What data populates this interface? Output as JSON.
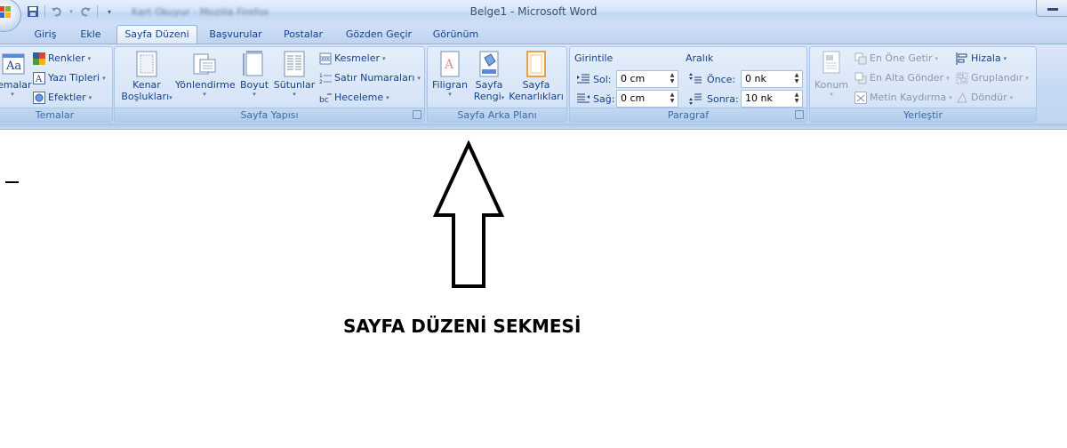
{
  "window": {
    "title": "Belge1 - Microsoft Word",
    "blurred_qat_text": "Kart Okuyur - Mozilla Firefox"
  },
  "qat": {
    "icons": [
      "save-icon",
      "undo-icon",
      "redo-icon",
      "customize-qat-icon"
    ]
  },
  "tabs": [
    {
      "label": "Giriş",
      "active": false
    },
    {
      "label": "Ekle",
      "active": false
    },
    {
      "label": "Sayfa Düzeni",
      "active": true
    },
    {
      "label": "Başvurular",
      "active": false
    },
    {
      "label": "Postalar",
      "active": false
    },
    {
      "label": "Gözden Geçir",
      "active": false
    },
    {
      "label": "Görünüm",
      "active": false
    }
  ],
  "groups": {
    "temalar": {
      "label": "Temalar",
      "themes_button": "emalar",
      "colors": "Renkler",
      "fonts": "Yazı Tipleri",
      "effects": "Efektler"
    },
    "sayfa_yapisi": {
      "label": "Sayfa Yapısı",
      "margins_line1": "Kenar",
      "margins_line2": "Boşlukları",
      "orientation": "Yönlendirme",
      "size": "Boyut",
      "columns": "Sütunlar",
      "breaks": "Kesmeler",
      "line_numbers": "Satır Numaraları",
      "hyphenation": "Heceleme"
    },
    "sayfa_arka_plani": {
      "label": "Sayfa Arka Planı",
      "watermark": "Filigran",
      "page_color_line1": "Sayfa",
      "page_color_line2": "Rengi",
      "page_borders_line1": "Sayfa",
      "page_borders_line2": "Kenarlıkları"
    },
    "paragraf": {
      "label": "Paragraf",
      "indent_title": "Girintile",
      "indent_left_label": "Sol:",
      "indent_left_value": "0 cm",
      "indent_right_label": "Sağ:",
      "indent_right_value": "0 cm",
      "spacing_title": "Aralık",
      "spacing_before_label": "Önce:",
      "spacing_before_value": "0 nk",
      "spacing_after_label": "Sonra:",
      "spacing_after_value": "10 nk"
    },
    "yerlestir": {
      "label": "Yerleştir",
      "position": "Konum",
      "bring_to_front": "En Öne Getir",
      "send_to_back": "En Alta Gönder",
      "text_wrapping": "Metin Kaydırma",
      "align": "Hizala",
      "group": "Gruplandır",
      "rotate": "Döndür"
    }
  },
  "document": {
    "annotation": "SAYFA DÜZENİ SEKMESİ"
  },
  "colors": {
    "ribbon": "#c5d9f3",
    "tab_text": "#15428b",
    "group_label": "#3e6aaa"
  }
}
